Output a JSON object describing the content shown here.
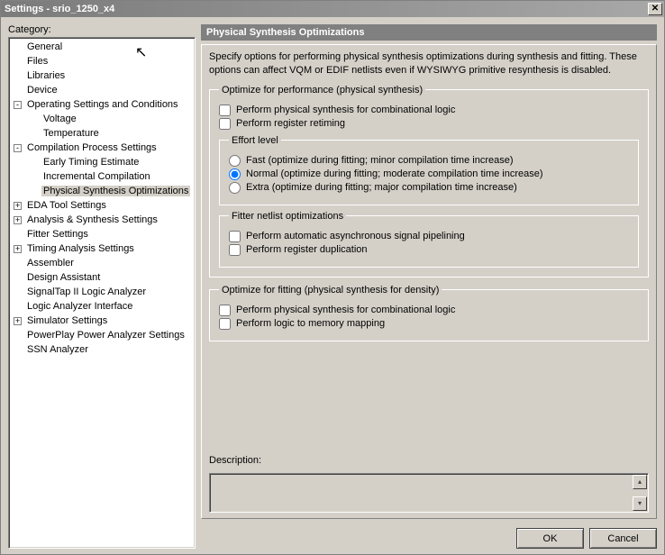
{
  "window": {
    "title": "Settings - srio_1250_x4"
  },
  "category": {
    "label": "Category:",
    "items": [
      {
        "label": "General",
        "level": 1,
        "joint": "",
        "selected": false
      },
      {
        "label": "Files",
        "level": 1,
        "joint": "",
        "selected": false
      },
      {
        "label": "Libraries",
        "level": 1,
        "joint": "",
        "selected": false
      },
      {
        "label": "Device",
        "level": 1,
        "joint": "",
        "selected": false
      },
      {
        "label": "Operating Settings and Conditions",
        "level": 1,
        "joint": "-",
        "selected": false
      },
      {
        "label": "Voltage",
        "level": 2,
        "joint": "",
        "selected": false
      },
      {
        "label": "Temperature",
        "level": 2,
        "joint": "",
        "selected": false
      },
      {
        "label": "Compilation Process Settings",
        "level": 1,
        "joint": "-",
        "selected": false
      },
      {
        "label": "Early Timing Estimate",
        "level": 2,
        "joint": "",
        "selected": false
      },
      {
        "label": "Incremental Compilation",
        "level": 2,
        "joint": "",
        "selected": false
      },
      {
        "label": "Physical Synthesis Optimizations",
        "level": 2,
        "joint": "",
        "selected": true
      },
      {
        "label": "EDA Tool Settings",
        "level": 1,
        "joint": "+",
        "selected": false
      },
      {
        "label": "Analysis & Synthesis Settings",
        "level": 1,
        "joint": "+",
        "selected": false
      },
      {
        "label": "Fitter Settings",
        "level": 1,
        "joint": "",
        "selected": false
      },
      {
        "label": "Timing Analysis Settings",
        "level": 1,
        "joint": "+",
        "selected": false
      },
      {
        "label": "Assembler",
        "level": 1,
        "joint": "",
        "selected": false
      },
      {
        "label": "Design Assistant",
        "level": 1,
        "joint": "",
        "selected": false
      },
      {
        "label": "SignalTap II Logic Analyzer",
        "level": 1,
        "joint": "",
        "selected": false
      },
      {
        "label": "Logic Analyzer Interface",
        "level": 1,
        "joint": "",
        "selected": false
      },
      {
        "label": "Simulator Settings",
        "level": 1,
        "joint": "+",
        "selected": false
      },
      {
        "label": "PowerPlay Power Analyzer Settings",
        "level": 1,
        "joint": "",
        "selected": false
      },
      {
        "label": "SSN Analyzer",
        "level": 1,
        "joint": "",
        "selected": false
      }
    ]
  },
  "panel": {
    "header": "Physical Synthesis Optimizations",
    "intro": "Specify options for performing physical synthesis optimizations during synthesis and fitting. These options can affect VQM or EDIF netlists even if WYSIWYG primitive resynthesis is disabled.",
    "perf_legend": "Optimize for performance (physical synthesis)",
    "perf_cb1": "Perform physical synthesis for combinational logic",
    "perf_cb2": "Perform register retiming",
    "effort_legend": "Effort level",
    "effort_r1": "Fast (optimize during fitting; minor compilation time increase)",
    "effort_r2": "Normal (optimize during fitting; moderate compilation time increase)",
    "effort_r3": "Extra (optimize during fitting; major compilation time increase)",
    "fitter_legend": "Fitter netlist optimizations",
    "fitter_cb1": "Perform automatic asynchronous signal pipelining",
    "fitter_cb2": "Perform register duplication",
    "fit_legend": "Optimize for fitting (physical synthesis for density)",
    "fit_cb1": "Perform physical synthesis for combinational logic",
    "fit_cb2": "Perform logic to memory mapping",
    "desc_label": "Description:"
  },
  "buttons": {
    "ok": "OK",
    "cancel": "Cancel"
  }
}
